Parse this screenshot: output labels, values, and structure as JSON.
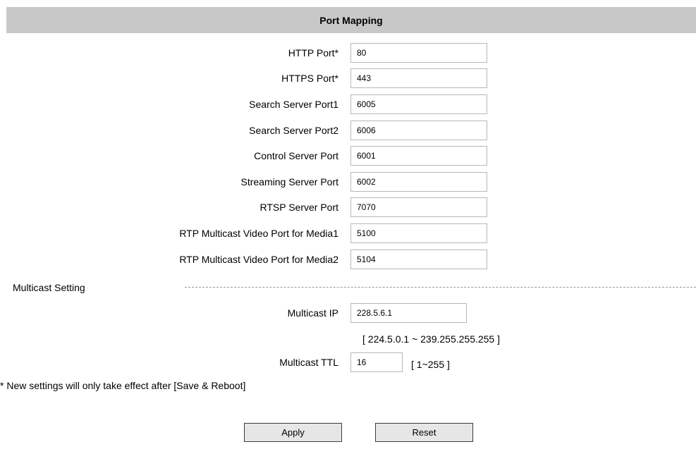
{
  "header": {
    "title": "Port Mapping"
  },
  "ports": [
    {
      "label": "HTTP Port*",
      "value": "80"
    },
    {
      "label": "HTTPS Port*",
      "value": "443"
    },
    {
      "label": "Search Server Port1",
      "value": "6005"
    },
    {
      "label": "Search Server Port2",
      "value": "6006"
    },
    {
      "label": "Control Server Port",
      "value": "6001"
    },
    {
      "label": "Streaming Server Port",
      "value": "6002"
    },
    {
      "label": "RTSP Server Port",
      "value": "7070"
    },
    {
      "label": "RTP Multicast Video Port for Media1",
      "value": "5100"
    },
    {
      "label": "RTP Multicast Video Port for Media2",
      "value": "5104"
    }
  ],
  "multicast": {
    "section_label": "Multicast Setting",
    "ip_label": "Multicast IP",
    "ip_value": "228.5.6.1",
    "ip_range": "[ 224.5.0.1 ~ 239.255.255.255 ]",
    "ttl_label": "Multicast TTL",
    "ttl_value": "16",
    "ttl_range": "[ 1~255 ]"
  },
  "note": "* New settings will only take effect after [Save & Reboot]",
  "buttons": {
    "apply": "Apply",
    "reset": "Reset"
  }
}
